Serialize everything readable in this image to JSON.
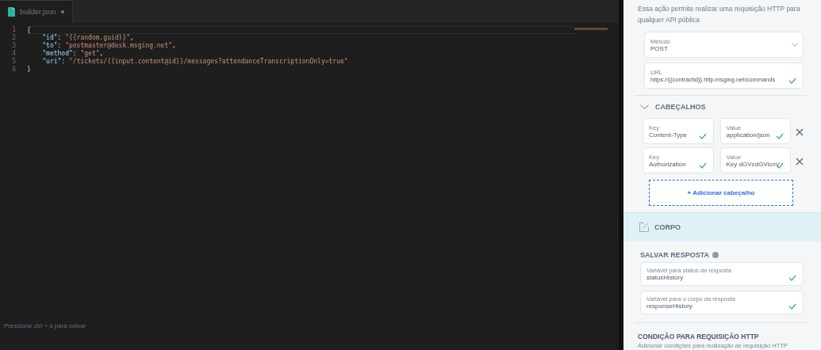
{
  "editor": {
    "tab": {
      "label": "builder.json",
      "modified": true,
      "selected": true
    },
    "lines": [
      {
        "number": "1",
        "tokens": [
          {
            "kind": "punct",
            "text": "{"
          }
        ]
      },
      {
        "number": "2",
        "tokens": [
          {
            "kind": "key",
            "text": "    \"id\""
          },
          {
            "kind": "punct",
            "text": ": "
          },
          {
            "kind": "string",
            "text": "\"{{random.guid}}\""
          },
          {
            "kind": "punct",
            "text": ","
          }
        ]
      },
      {
        "number": "3",
        "tokens": [
          {
            "kind": "key",
            "text": "    \"to\""
          },
          {
            "kind": "punct",
            "text": ": "
          },
          {
            "kind": "string",
            "text": "\"postmaster@desk.msging.net\""
          },
          {
            "kind": "punct",
            "text": ","
          }
        ]
      },
      {
        "number": "4",
        "tokens": [
          {
            "kind": "key",
            "text": "    \"method\""
          },
          {
            "kind": "punct",
            "text": ": "
          },
          {
            "kind": "string",
            "text": "\"get\""
          },
          {
            "kind": "punct",
            "text": ","
          }
        ]
      },
      {
        "number": "5",
        "tokens": [
          {
            "kind": "key",
            "text": "    \"uri\""
          },
          {
            "kind": "punct",
            "text": ": "
          },
          {
            "kind": "string",
            "text": "\"/tickets/{{input.content@id}}/messages?attendanceTranscriptionOnly=true\""
          }
        ]
      },
      {
        "number": "6",
        "tokens": [
          {
            "kind": "punct",
            "text": "}"
          }
        ]
      }
    ],
    "hint": "Pressione ctrl + s para salvar"
  },
  "panel": {
    "description": "Essa ação permite realizar uma requisição HTTP para qualquer API pública",
    "method": {
      "label": "Método",
      "value": "POST"
    },
    "url": {
      "label": "URL",
      "value": "https://{{contractid}}.http.msging.net/commands",
      "valid": true
    },
    "headers": {
      "title": "CABEÇALHOS",
      "expanded": true,
      "rows": [
        {
          "key_label": "Key",
          "key": "Content-Type",
          "key_valid": true,
          "value_label": "Value",
          "value": "application/json",
          "value_valid": true
        },
        {
          "key_label": "Key",
          "key": "Authorization",
          "key_valid": true,
          "value_label": "Value",
          "value": "Key dGVzdGVicnV",
          "value_valid": true
        }
      ],
      "add_button": "+ Adicionar cabeçalho"
    },
    "body": {
      "title": "CORPO"
    },
    "save_response": {
      "title": "SALVAR RESPOSTA",
      "fields": [
        {
          "label": "Variável para status da resposta",
          "value": "statusHistory",
          "valid": true
        },
        {
          "label": "Variável para o corpo da resposta",
          "value": "responseHistory",
          "valid": true
        }
      ]
    },
    "condition": {
      "title": "CONDIÇÃO PARA REQUISIÇÃO HTTP",
      "description": "Adicionar condições para realização de requisição HTTP"
    }
  }
}
